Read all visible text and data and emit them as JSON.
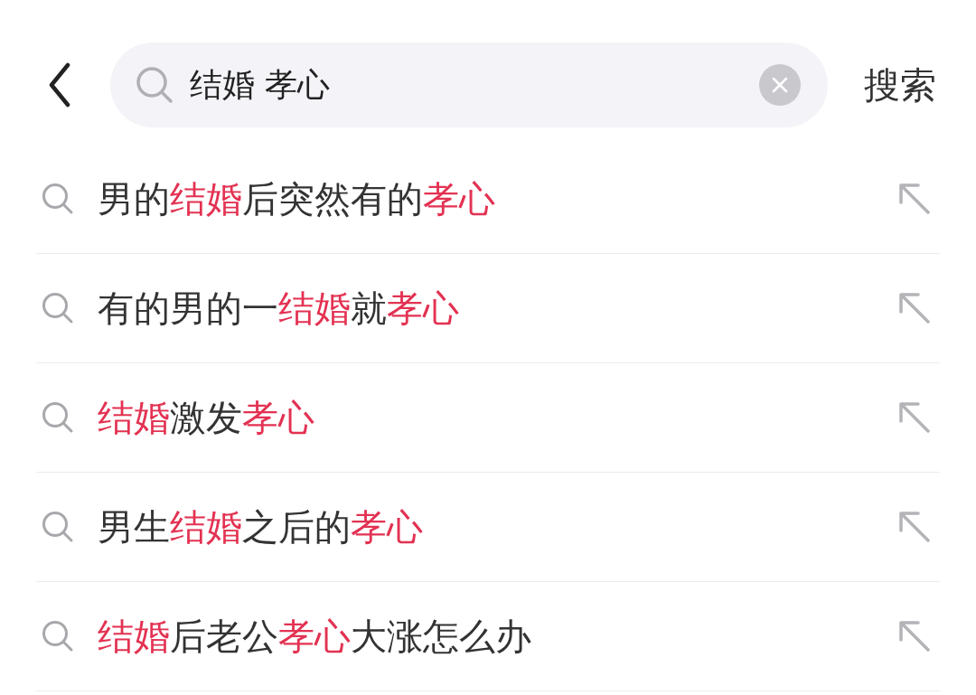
{
  "search_bar": {
    "query": "结婚 孝心",
    "search_button": "搜索"
  },
  "suggestions": [
    {
      "parts": [
        {
          "text": "男的",
          "highlighted": false
        },
        {
          "text": "结婚",
          "highlighted": true
        },
        {
          "text": "后突然有的",
          "highlighted": false
        },
        {
          "text": "孝心",
          "highlighted": true
        }
      ]
    },
    {
      "parts": [
        {
          "text": "有的男的一",
          "highlighted": false
        },
        {
          "text": "结婚",
          "highlighted": true
        },
        {
          "text": "就",
          "highlighted": false
        },
        {
          "text": "孝心",
          "highlighted": true
        }
      ]
    },
    {
      "parts": [
        {
          "text": "结婚",
          "highlighted": true
        },
        {
          "text": "激发",
          "highlighted": false
        },
        {
          "text": "孝心",
          "highlighted": true
        }
      ]
    },
    {
      "parts": [
        {
          "text": "男生",
          "highlighted": false
        },
        {
          "text": "结婚",
          "highlighted": true
        },
        {
          "text": "之后的",
          "highlighted": false
        },
        {
          "text": "孝心",
          "highlighted": true
        }
      ]
    },
    {
      "parts": [
        {
          "text": "结婚",
          "highlighted": true
        },
        {
          "text": "后老公",
          "highlighted": false
        },
        {
          "text": "孝心",
          "highlighted": true
        },
        {
          "text": "大涨怎么办",
          "highlighted": false
        }
      ]
    }
  ]
}
